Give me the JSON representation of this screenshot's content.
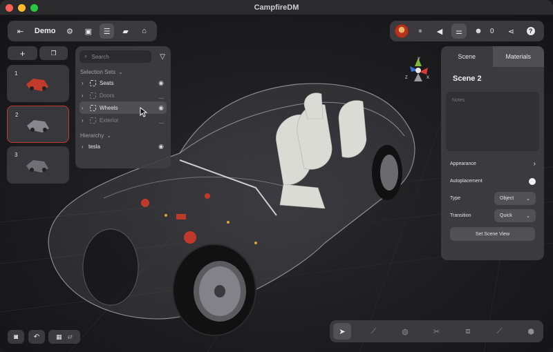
{
  "app": {
    "title": "CampfireDM"
  },
  "toolbar": {
    "project_name": "Demo",
    "collaborator_count": "0"
  },
  "scenes": [
    {
      "number": "1"
    },
    {
      "number": "2"
    },
    {
      "number": "3"
    }
  ],
  "sets_panel": {
    "search_placeholder": "Search",
    "selection_sets_label": "Selection Sets",
    "selection_sets": [
      {
        "label": "Seats",
        "visible": true
      },
      {
        "label": "Doors",
        "visible": false
      },
      {
        "label": "Wheels",
        "visible": true
      },
      {
        "label": "Exterior",
        "visible": false
      }
    ],
    "hierarchy_label": "Hierarchy",
    "hierarchy": [
      {
        "label": "tesla",
        "visible": true
      }
    ]
  },
  "right_panel": {
    "tabs": [
      "Scene",
      "Materials"
    ],
    "scene_name": "Scene 2",
    "notes_placeholder": "Notes",
    "appearance_label": "Appearance",
    "autoplacement_label": "Autoplacement",
    "type_label": "Type",
    "type_value": "Object",
    "transition_label": "Transition",
    "transition_value": "Quick",
    "set_scene_view_label": "Set Scene View"
  },
  "colors": {
    "accent_selected": "#c23a2a",
    "close_dot": "#ff5f57",
    "minimize_dot": "#febc2e",
    "zoom_dot": "#28c840"
  },
  "icons": {
    "bottom_tools": [
      "select-arrow-icon",
      "laser-pointer-icon",
      "comment-icon",
      "cut-icon",
      "slice-icon",
      "measure-icon",
      "shape-icon"
    ]
  }
}
